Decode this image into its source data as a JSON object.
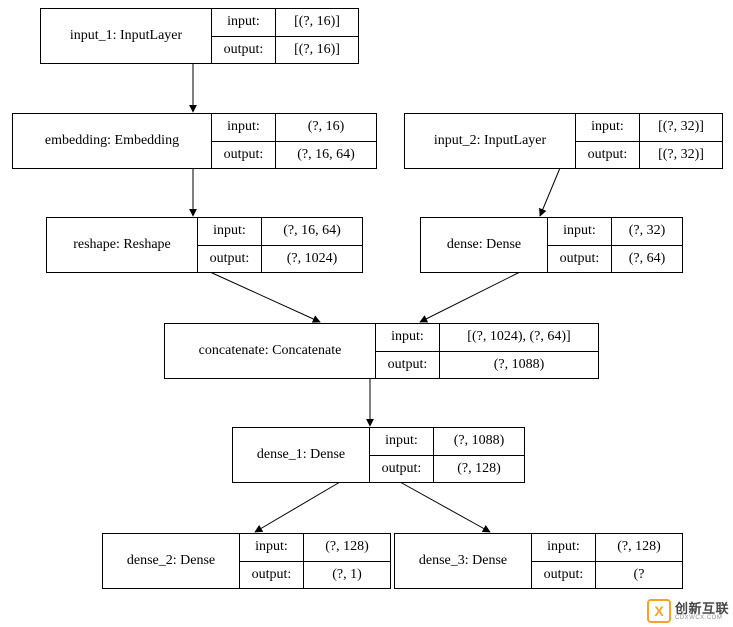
{
  "io_labels": {
    "input": "input:",
    "output": "output:"
  },
  "nodes": {
    "input_1": {
      "name": "input_1: InputLayer",
      "input": "[(?, 16)]",
      "output": "[(?, 16)]"
    },
    "embedding": {
      "name": "embedding: Embedding",
      "input": "(?, 16)",
      "output": "(?, 16, 64)"
    },
    "input_2": {
      "name": "input_2: InputLayer",
      "input": "[(?, 32)]",
      "output": "[(?, 32)]"
    },
    "reshape": {
      "name": "reshape: Reshape",
      "input": "(?, 16, 64)",
      "output": "(?, 1024)"
    },
    "dense": {
      "name": "dense: Dense",
      "input": "(?, 32)",
      "output": "(?, 64)"
    },
    "concat": {
      "name": "concatenate: Concatenate",
      "input": "[(?, 1024), (?, 64)]",
      "output": "(?, 1088)"
    },
    "dense_1": {
      "name": "dense_1: Dense",
      "input": "(?, 1088)",
      "output": "(?, 128)"
    },
    "dense_2": {
      "name": "dense_2: Dense",
      "input": "(?, 128)",
      "output": "(?, 1)"
    },
    "dense_3": {
      "name": "dense_3: Dense",
      "input": "(?, 128)",
      "output": "(?"
    }
  },
  "watermark": {
    "icon_letter": "X",
    "main": "创新互联",
    "sub": "CDXWCX.COM"
  }
}
